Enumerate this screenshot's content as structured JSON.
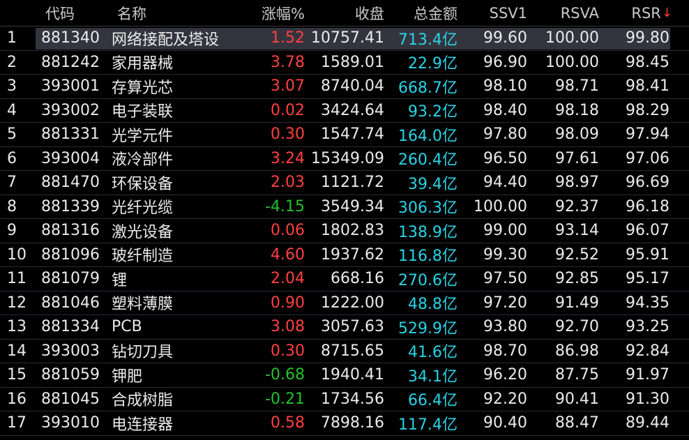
{
  "header": {
    "idx": "",
    "code": "代码",
    "name": "名称",
    "change": "涨幅%",
    "close": "收盘",
    "amount": "总金额",
    "ssv1": "SSV1",
    "rsva": "RSVA",
    "rsr": "RSR",
    "sort_arrow": "↓"
  },
  "rows": [
    {
      "idx": "1",
      "code": "881340",
      "name": "网络接配及塔设",
      "change": "1.52",
      "dir": "up",
      "close": "10757.41",
      "amount": "713.4亿",
      "ssv1": "99.60",
      "rsva": "100.00",
      "rsr": "99.80"
    },
    {
      "idx": "2",
      "code": "881242",
      "name": "家用器械",
      "change": "3.78",
      "dir": "up",
      "close": "1589.01",
      "amount": "22.9亿",
      "ssv1": "96.90",
      "rsva": "100.00",
      "rsr": "98.45"
    },
    {
      "idx": "3",
      "code": "393001",
      "name": "存算光芯",
      "change": "3.07",
      "dir": "up",
      "close": "8740.04",
      "amount": "668.7亿",
      "ssv1": "98.10",
      "rsva": "98.71",
      "rsr": "98.41"
    },
    {
      "idx": "4",
      "code": "393002",
      "name": "电子装联",
      "change": "0.02",
      "dir": "up",
      "close": "3424.64",
      "amount": "93.2亿",
      "ssv1": "98.40",
      "rsva": "98.18",
      "rsr": "98.29"
    },
    {
      "idx": "5",
      "code": "881331",
      "name": "光学元件",
      "change": "0.30",
      "dir": "up",
      "close": "1547.74",
      "amount": "164.0亿",
      "ssv1": "97.80",
      "rsva": "98.09",
      "rsr": "97.94"
    },
    {
      "idx": "6",
      "code": "393004",
      "name": "液冷部件",
      "change": "3.24",
      "dir": "up",
      "close": "15349.09",
      "amount": "260.4亿",
      "ssv1": "96.50",
      "rsva": "97.61",
      "rsr": "97.06"
    },
    {
      "idx": "7",
      "code": "881470",
      "name": "环保设备",
      "change": "2.03",
      "dir": "up",
      "close": "1121.72",
      "amount": "39.4亿",
      "ssv1": "94.40",
      "rsva": "98.97",
      "rsr": "96.69"
    },
    {
      "idx": "8",
      "code": "881339",
      "name": "光纤光缆",
      "change": "-4.15",
      "dir": "down",
      "close": "3549.34",
      "amount": "306.3亿",
      "ssv1": "100.00",
      "rsva": "92.37",
      "rsr": "96.18"
    },
    {
      "idx": "9",
      "code": "881316",
      "name": "激光设备",
      "change": "0.06",
      "dir": "up",
      "close": "1802.83",
      "amount": "138.9亿",
      "ssv1": "99.00",
      "rsva": "93.14",
      "rsr": "96.07"
    },
    {
      "idx": "10",
      "code": "881096",
      "name": "玻纤制造",
      "change": "4.60",
      "dir": "up",
      "close": "1937.62",
      "amount": "116.8亿",
      "ssv1": "99.30",
      "rsva": "92.52",
      "rsr": "95.91"
    },
    {
      "idx": "11",
      "code": "881079",
      "name": "锂",
      "change": "2.04",
      "dir": "up",
      "close": "668.16",
      "amount": "270.6亿",
      "ssv1": "97.50",
      "rsva": "92.85",
      "rsr": "95.17"
    },
    {
      "idx": "12",
      "code": "881046",
      "name": "塑料薄膜",
      "change": "0.90",
      "dir": "up",
      "close": "1222.00",
      "amount": "48.8亿",
      "ssv1": "97.20",
      "rsva": "91.49",
      "rsr": "94.35"
    },
    {
      "idx": "13",
      "code": "881334",
      "name": "PCB",
      "change": "3.08",
      "dir": "up",
      "close": "3057.63",
      "amount": "529.9亿",
      "ssv1": "93.80",
      "rsva": "92.70",
      "rsr": "93.25"
    },
    {
      "idx": "14",
      "code": "393003",
      "name": "钻切刀具",
      "change": "0.30",
      "dir": "up",
      "close": "8715.65",
      "amount": "41.6亿",
      "ssv1": "98.70",
      "rsva": "86.98",
      "rsr": "92.84"
    },
    {
      "idx": "15",
      "code": "881059",
      "name": "钾肥",
      "change": "-0.68",
      "dir": "down",
      "close": "1940.41",
      "amount": "34.1亿",
      "ssv1": "96.20",
      "rsva": "87.75",
      "rsr": "91.97"
    },
    {
      "idx": "16",
      "code": "881045",
      "name": "合成树脂",
      "change": "-0.21",
      "dir": "down",
      "close": "1734.56",
      "amount": "66.4亿",
      "ssv1": "92.20",
      "rsva": "90.41",
      "rsr": "91.30"
    },
    {
      "idx": "17",
      "code": "393010",
      "name": "电连接器",
      "change": "0.58",
      "dir": "up",
      "close": "7898.16",
      "amount": "117.4亿",
      "ssv1": "90.40",
      "rsva": "88.47",
      "rsr": "89.44"
    }
  ],
  "colors": {
    "background": "#000000",
    "up": "#ff4040",
    "down": "#22c22c",
    "amount": "#29d3e6",
    "selected_row": "#34343e"
  },
  "selected_row_index": 0
}
